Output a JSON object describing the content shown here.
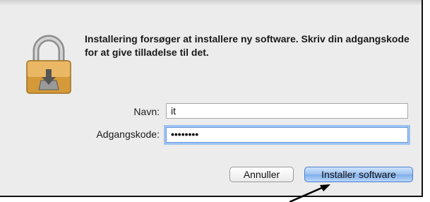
{
  "dialog": {
    "message": "Installering forsøger at installere ny software. Skriv din adgangskode for at give tilladelse til det.",
    "lock_icon": "padlock-download-icon"
  },
  "form": {
    "name_label": "Navn:",
    "name_value": "it",
    "password_label": "Adgangskode:",
    "password_value": "••••••••"
  },
  "buttons": {
    "cancel_label": "Annuller",
    "install_label": "Installer software"
  },
  "colors": {
    "dialog_bg": "#ececec",
    "focus_ring": "#9ec2f1",
    "default_button": "#7eaee9"
  }
}
